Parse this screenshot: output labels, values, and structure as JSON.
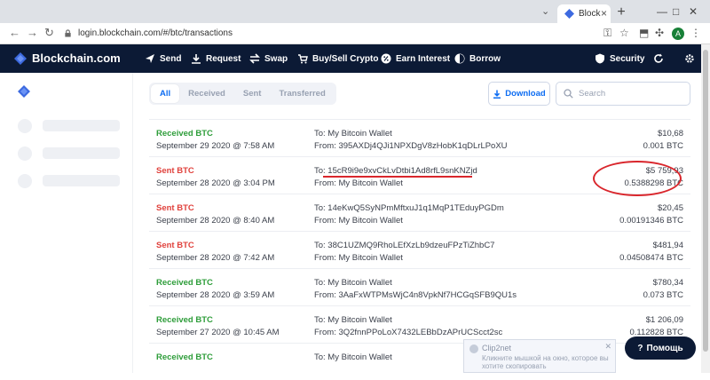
{
  "browser": {
    "tab_title": "Block",
    "url": "login.blockchain.com/#/btc/transactions",
    "profile_initial": "A"
  },
  "header": {
    "brand": "Blockchain.com",
    "nav": {
      "send": "Send",
      "request": "Request",
      "swap": "Swap",
      "buy_sell": "Buy/Sell Crypto",
      "earn": "Earn Interest",
      "borrow": "Borrow",
      "security": "Security"
    }
  },
  "filters": {
    "all": "All",
    "received": "Received",
    "sent": "Sent",
    "transferred": "Transferred"
  },
  "toolbar": {
    "download_label": "Download",
    "search_placeholder": "Search"
  },
  "transactions": [
    {
      "kind": "Received BTC",
      "type": "received",
      "date": "September 29 2020 @ 7:58 AM",
      "to": "To: My Bitcoin Wallet",
      "from": "From: 395AXDj4QJi1NPXDgV8zHobK1qDLrLPoXU",
      "fiat": "$10,68",
      "crypto": "0.001 BTC"
    },
    {
      "kind": "Sent BTC",
      "type": "sent",
      "date": "September 28 2020 @ 3:04 PM",
      "to": "To: 15cR9i9e9xvCkLvDtbi1Ad8rfL9snKNZjd",
      "from": "From: My Bitcoin Wallet",
      "fiat": "$5 759,93",
      "crypto": "0.5388298 BTC"
    },
    {
      "kind": "Sent BTC",
      "type": "sent",
      "date": "September 28 2020 @ 8:40 AM",
      "to": "To: 14eKwQ5SyNPmMftxuJ1q1MqP1TEduyPGDm",
      "from": "From: My Bitcoin Wallet",
      "fiat": "$20,45",
      "crypto": "0.00191346 BTC"
    },
    {
      "kind": "Sent BTC",
      "type": "sent",
      "date": "September 28 2020 @ 7:42 AM",
      "to": "To: 38C1UZMQ9RhoLEfXzLb9dzeuFPzTiZhbC7",
      "from": "From: My Bitcoin Wallet",
      "fiat": "$481,94",
      "crypto": "0.04508474 BTC"
    },
    {
      "kind": "Received BTC",
      "type": "received",
      "date": "September 28 2020 @ 3:59 AM",
      "to": "To: My Bitcoin Wallet",
      "from": "From: 3AaFxWTPMsWjC4n8VpkNf7HCGqSFB9QU1s",
      "fiat": "$780,34",
      "crypto": "0.073 BTC"
    },
    {
      "kind": "Received BTC",
      "type": "received",
      "date": "September 27 2020 @ 10:45 AM",
      "to": "To: My Bitcoin Wallet",
      "from": "From: 3Q2fnnPPoLoX7432LEBbDzAPrUCScct2sc",
      "fiat": "$1 206,09",
      "crypto": "0.112828 BTC"
    },
    {
      "kind": "Received BTC",
      "type": "received",
      "date": "",
      "to": "To: My Bitcoin Wallet",
      "from": "",
      "fiat": "",
      "crypto": ""
    }
  ],
  "toast": {
    "title": "Clip2net",
    "message": "Кликните мышкой на окно, которое вы хотите скопировать"
  },
  "help": {
    "label": "Помощь"
  }
}
